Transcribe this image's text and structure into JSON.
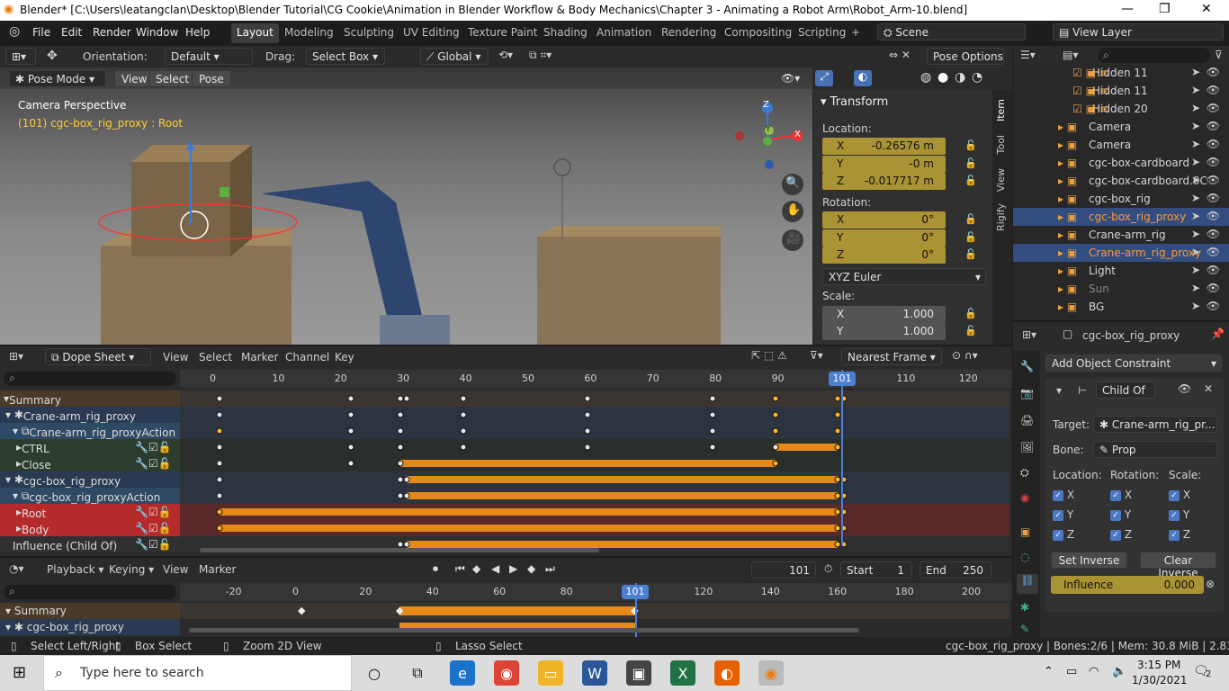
{
  "window": {
    "title": "Blender* [C:\\Users\\leatangclan\\Desktop\\Blender Tutorial\\CG Cookie\\Animation in Blender Workflow & Body Mechanics\\Chapter 3 - Animating a Robot Arm\\Robot_Arm-10.blend]",
    "minimize": "—",
    "maximize": "❐",
    "close": "✕"
  },
  "menu": [
    "File",
    "Edit",
    "Render",
    "Window",
    "Help"
  ],
  "workspaces": [
    "Layout",
    "Modeling",
    "Sculpting",
    "UV Editing",
    "Texture Paint",
    "Shading",
    "Animation",
    "Rendering",
    "Compositing",
    "Scripting"
  ],
  "add_tab": "+",
  "scene": "Scene",
  "view_layer": "View Layer",
  "toolbar": {
    "orientation_label": "Orientation:",
    "orientation": "Default",
    "drag_label": "Drag:",
    "drag": "Select Box",
    "transform": "Global",
    "pose_options": "Pose Options"
  },
  "viewport_header": {
    "mode": "Pose Mode",
    "view": "View",
    "select": "Select",
    "pose": "Pose"
  },
  "viewport": {
    "camera_text": "Camera Perspective",
    "object_text": "(101) cgc-box_rig_proxy : Root",
    "gizmo_x": "X",
    "gizmo_y": "Y",
    "gizmo_z": "Z"
  },
  "npanel": {
    "tab": "Transform",
    "location_label": "Location:",
    "loc": [
      {
        "ax": "X",
        "v": "-0.26576 m"
      },
      {
        "ax": "Y",
        "v": "-0 m"
      },
      {
        "ax": "Z",
        "v": "-0.017717 m"
      }
    ],
    "rotation_label": "Rotation:",
    "rot": [
      {
        "ax": "X",
        "v": "0°"
      },
      {
        "ax": "Y",
        "v": "0°"
      },
      {
        "ax": "Z",
        "v": "0°"
      }
    ],
    "euler": "XYZ Euler",
    "scale_label": "Scale:",
    "scale": [
      {
        "ax": "X",
        "v": "1.000"
      },
      {
        "ax": "Y",
        "v": "1.000"
      }
    ],
    "tabs": [
      "Item",
      "Tool",
      "View",
      "Rigify"
    ]
  },
  "outliner": [
    {
      "name": "Hidden 11",
      "sel": false
    },
    {
      "name": "Hidden 11",
      "sel": false
    },
    {
      "name": "Hidden 20",
      "sel": false
    },
    {
      "name": "Camera",
      "sel": false
    },
    {
      "name": "Camera",
      "sel": false
    },
    {
      "name": "cgc-box-cardboard",
      "sel": false
    },
    {
      "name": "cgc-box-cardboard.0C",
      "sel": false
    },
    {
      "name": "cgc-box_rig",
      "sel": false
    },
    {
      "name": "cgc-box_rig_proxy",
      "sel": true
    },
    {
      "name": "Crane-arm_rig",
      "sel": false
    },
    {
      "name": "Crane-arm_rig_proxy",
      "sel": true
    },
    {
      "name": "Light",
      "sel": false
    },
    {
      "name": "Sun",
      "sel": false
    },
    {
      "name": "BG",
      "sel": false
    }
  ],
  "properties": {
    "object": "cgc-box_rig_proxy",
    "add_constraint": "Add Object Constraint",
    "constraint_name": "Child Of",
    "target_label": "Target:",
    "target": "Crane-arm_rig_pr...",
    "bone_label": "Bone:",
    "bone": "Prop",
    "loc_label": "Location:",
    "rot_label": "Rotation:",
    "scale_label": "Scale:",
    "axes": [
      "X",
      "Y",
      "Z"
    ],
    "set_inverse": "Set Inverse",
    "clear_inverse": "Clear Inverse",
    "influence_label": "Influence",
    "influence": "0.000"
  },
  "dopesheet": {
    "mode": "Dope Sheet",
    "menus": [
      "View",
      "Select",
      "Marker",
      "Channel",
      "Key"
    ],
    "snap": "Nearest Frame",
    "current_frame": "101",
    "ticks": [
      "0",
      "10",
      "20",
      "30",
      "40",
      "50",
      "60",
      "70",
      "80",
      "90",
      "110",
      "120"
    ],
    "channels": [
      {
        "name": "Summary",
        "indent": 0,
        "color": "#4a3a2a"
      },
      {
        "name": "Crane-arm_rig_proxy",
        "indent": 1,
        "color": "#2a3a52"
      },
      {
        "name": "Crane-arm_rig_proxyAction",
        "indent": 2,
        "color": "#2f4a64"
      },
      {
        "name": "CTRL",
        "indent": 3,
        "color": "#2d3d2d"
      },
      {
        "name": "Close",
        "indent": 3,
        "color": "#2d3d2d"
      },
      {
        "name": "cgc-box_rig_proxy",
        "indent": 1,
        "color": "#2a3a52"
      },
      {
        "name": "cgc-box_rig_proxyAction",
        "indent": 2,
        "color": "#2f4a64"
      },
      {
        "name": "Root",
        "indent": 3,
        "color": "#b52b2b"
      },
      {
        "name": "Body",
        "indent": 3,
        "color": "#b52b2b"
      },
      {
        "name": "Influence (Child Of)",
        "indent": 2,
        "color": "#303030"
      }
    ]
  },
  "timeline": {
    "playback": "Playback",
    "keying": "Keying",
    "view": "View",
    "marker": "Marker",
    "frame": "101",
    "start_label": "Start",
    "start": "1",
    "end_label": "End",
    "end": "250",
    "ticks": [
      "-20",
      "0",
      "20",
      "40",
      "60",
      "80",
      "120",
      "140",
      "160",
      "180",
      "200"
    ],
    "rows": [
      "Summary",
      "cgc-box_rig_proxy"
    ]
  },
  "status": {
    "select": "Select Left/Right",
    "box": "Box Select",
    "zoom": "Zoom 2D View",
    "lasso": "Lasso Select",
    "info": "cgc-box_rig_proxy | Bones:2/6 | Mem: 30.8 MiB | 2.83.3"
  },
  "taskbar": {
    "search": "Type here to search",
    "time": "3:15 PM",
    "date": "1/30/2021",
    "notif": "2"
  }
}
